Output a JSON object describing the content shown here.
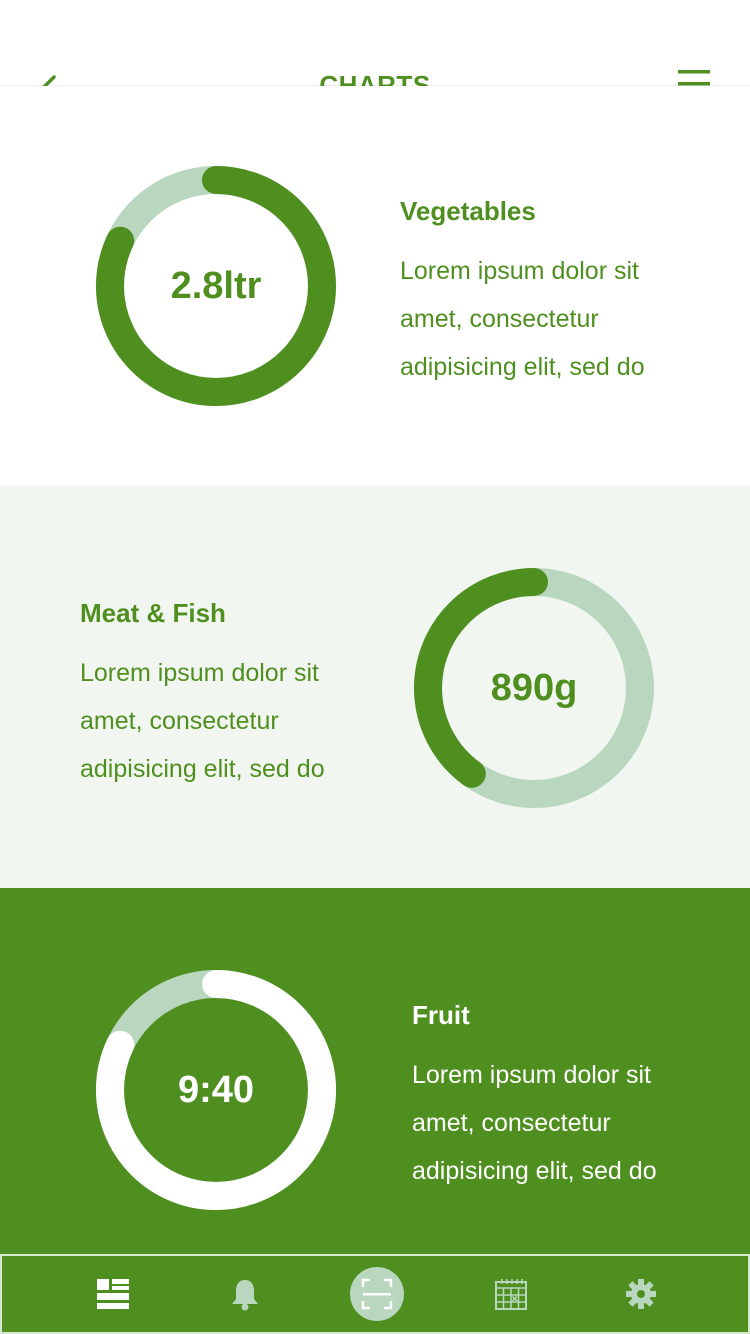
{
  "header": {
    "title": "CHARTS",
    "back_icon": "arrow-left-icon",
    "menu_icon": "hamburger-menu-icon"
  },
  "colors": {
    "primary": "#4f8f1f",
    "track": "#b9d6bf",
    "section_light": "#f2f6f0",
    "white": "#ffffff"
  },
  "charts": [
    {
      "title": "Vegetables",
      "value": "2.8ltr",
      "progress": 0.82,
      "description": [
        "Lorem ipsum dolor sit",
        "amet, consectetur",
        "adipisicing elit, sed do"
      ]
    },
    {
      "title": "Meat & Fish",
      "value": "890g",
      "progress": 0.4,
      "description": [
        "Lorem ipsum dolor sit",
        "amet, consectetur",
        "adipisicing elit, sed do"
      ]
    },
    {
      "title": "Fruit",
      "value": "9:40",
      "progress": 0.82,
      "description": [
        "Lorem ipsum dolor sit",
        "amet, consectetur",
        "adipisicing elit, sed do"
      ]
    }
  ],
  "tabbar": {
    "items": [
      {
        "icon": "dashboard-icon",
        "active": true
      },
      {
        "icon": "bell-icon",
        "active": false
      },
      {
        "icon": "scan-icon",
        "active": false
      },
      {
        "icon": "calendar-icon",
        "active": false
      },
      {
        "icon": "gear-icon",
        "active": false
      }
    ]
  }
}
